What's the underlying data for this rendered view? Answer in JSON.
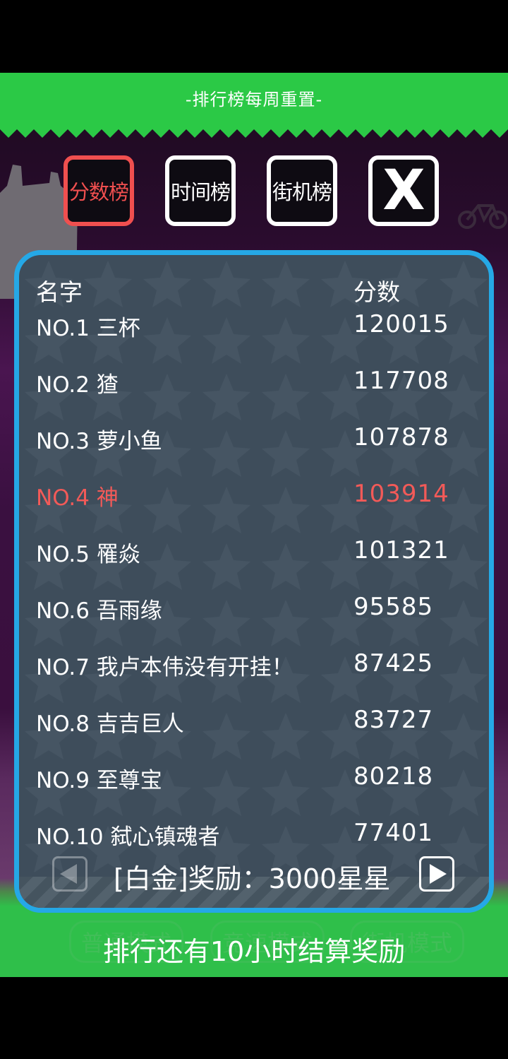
{
  "banner": {
    "text": "-排行榜每周重置-"
  },
  "tabs": [
    {
      "label": "分数榜",
      "active": true
    },
    {
      "label": "时间榜",
      "active": false
    },
    {
      "label": "街机榜",
      "active": false
    }
  ],
  "close": {
    "label": "X"
  },
  "background_modes": [
    "普通模式",
    "竞速模式",
    "街机模式"
  ],
  "table": {
    "headers": {
      "name": "名字",
      "score": "分数"
    },
    "rows": [
      {
        "rank_name": "NO.1 三杯",
        "score": "120015",
        "highlight": false
      },
      {
        "rank_name": "NO.2 猹",
        "score": "117708",
        "highlight": false
      },
      {
        "rank_name": "NO.3 萝小鱼",
        "score": "107878",
        "highlight": false
      },
      {
        "rank_name": "NO.4 神",
        "score": "103914",
        "highlight": true
      },
      {
        "rank_name": "NO.5 罹焱",
        "score": "101321",
        "highlight": false
      },
      {
        "rank_name": "NO.6 吾雨缘",
        "score": "95585",
        "highlight": false
      },
      {
        "rank_name": "NO.7 我卢本伟没有开挂！",
        "score": "87425",
        "highlight": false
      },
      {
        "rank_name": "NO.8 吉吉巨人",
        "score": "83727",
        "highlight": false
      },
      {
        "rank_name": "NO.9 至尊宝",
        "score": "80218",
        "highlight": false
      },
      {
        "rank_name": "NO.10 弑心镇魂者",
        "score": "77401",
        "highlight": false
      }
    ]
  },
  "reward": {
    "text": "[白金]奖励：3000星星"
  },
  "footer": {
    "text": "排行还有10小时结算奖励"
  },
  "colors": {
    "accent_red": "#f25a58",
    "banner_green": "#2bc946",
    "panel_border_blue": "#25a8e6",
    "panel_bg": "#3e4d5b"
  },
  "icons": {
    "prev": "left-triangle-arrow-icon",
    "next": "right-triangle-arrow-icon",
    "close": "x-icon"
  }
}
